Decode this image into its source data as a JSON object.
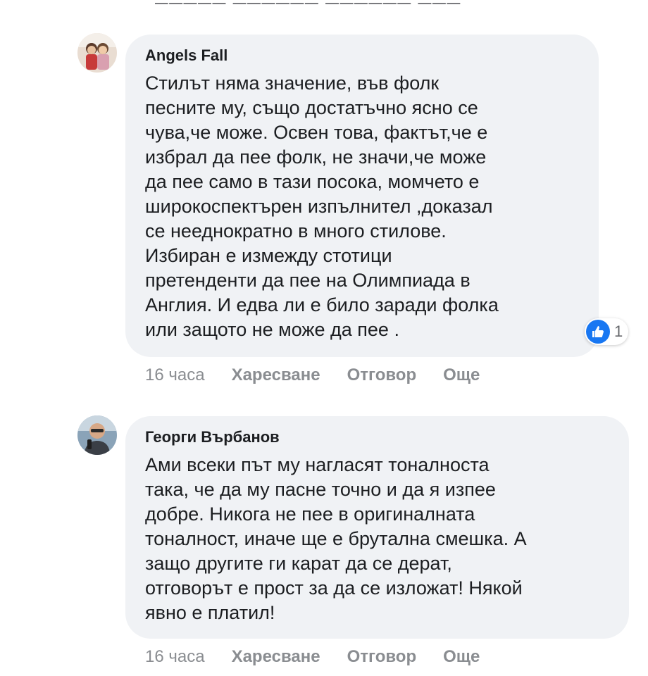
{
  "comments": [
    {
      "author": "Angels Fall",
      "lines": [
        "Стилът няма значение, във фолк",
        "песните му, също достатъчно ясно се",
        "чува,че може. Освен това, фактът,че е",
        "избрал да пее фолк, не значи,че може",
        "да пее само в тази посока, момчето е",
        "широкоспектърен изпълнител ,доказал",
        "се нееднократно в много стилове.",
        "Избиран е измежду стотици",
        "претенденти да пее на Олимпиада в",
        "Англия. И едва ли е било заради фолка",
        "или защото не може да пее ."
      ],
      "reaction": {
        "icon": "like-icon",
        "count": "1"
      },
      "time": "16 часа",
      "actions": {
        "like": "Харесване",
        "reply": "Отговор",
        "more": "Още"
      }
    },
    {
      "author": "Георги Върбанов",
      "lines": [
        "Ами всеки път му нагласят тоналноста",
        "така, че да му пасне точно и да я изпее",
        "добре. Никога не пее в оригиналната",
        "тоналност, иначе ще е брутална смешка. А",
        "защо другите ги карат да се дерат,",
        "отговорът е прост за да се изложат! Някой",
        "явно е платил!"
      ],
      "time": "16 часа",
      "actions": {
        "like": "Харесване",
        "reply": "Отговор",
        "more": "Още"
      }
    }
  ],
  "colors": {
    "bubble": "#f0f2f5",
    "like_blue": "#1877f2",
    "meta_gray": "#8a8d91",
    "text": "#1c1e21"
  }
}
